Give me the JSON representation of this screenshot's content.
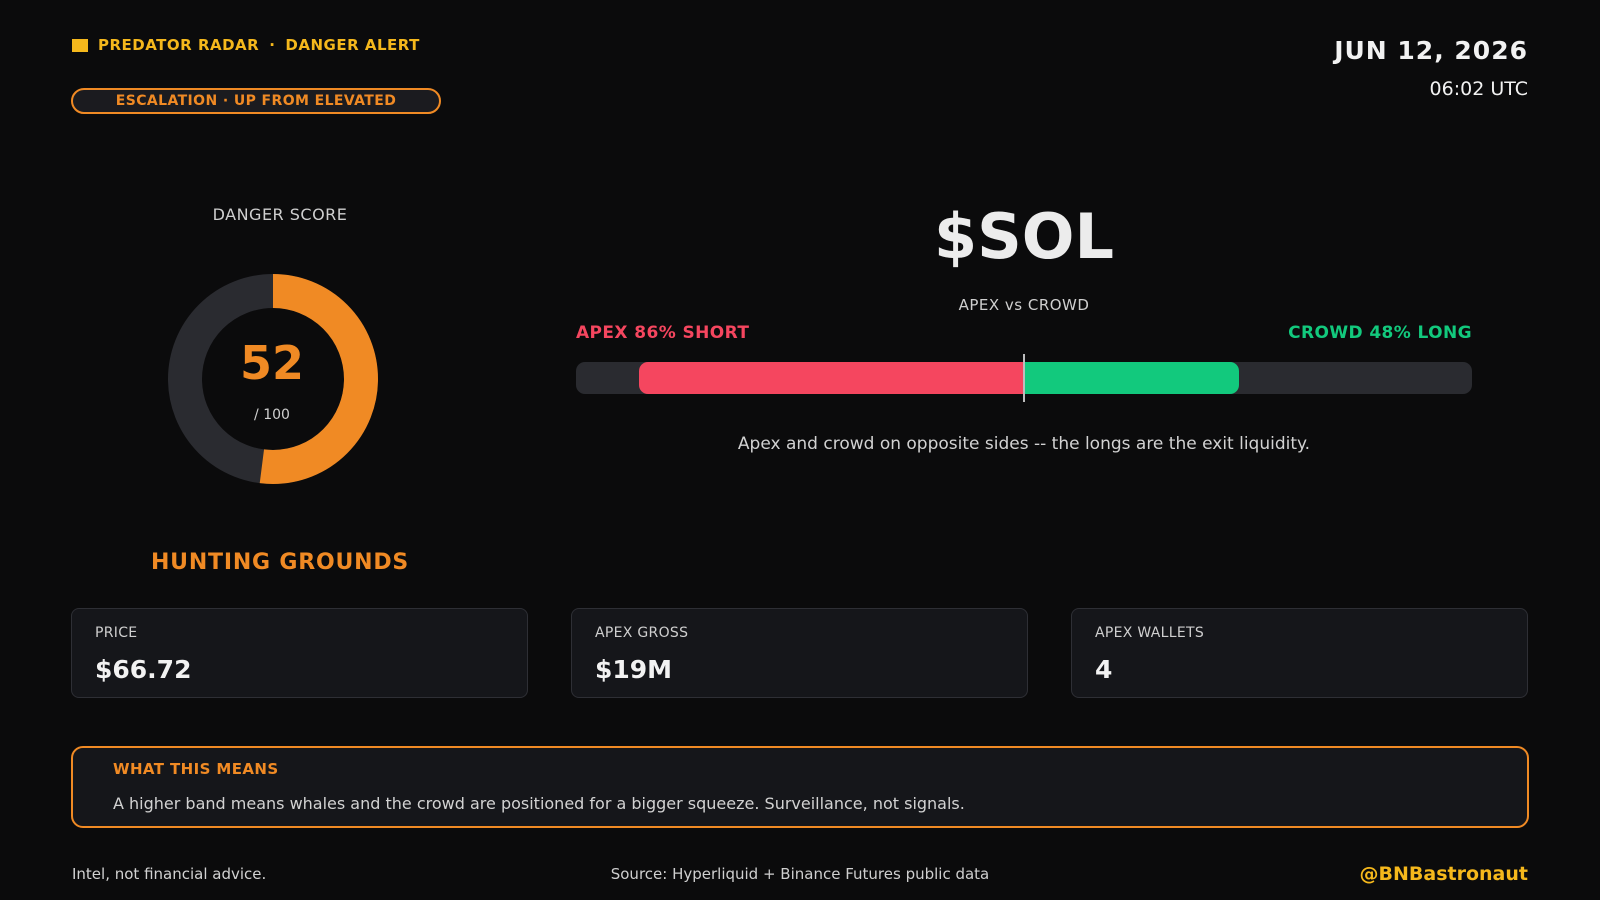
{
  "header": {
    "brand_left": "PREDATOR RADAR",
    "brand_sep": "·",
    "brand_right": "DANGER ALERT",
    "escalation": "ESCALATION · UP FROM ELEVATED",
    "date": "JUN 12, 2026",
    "time": "06:02 UTC"
  },
  "danger": {
    "label": "DANGER SCORE",
    "score": "52",
    "max": "/ 100",
    "fraction": 0.52
  },
  "positioning": {
    "ticker": "$SOL",
    "vs_label": "APEX  vs  CROWD",
    "apex_label": "APEX 86% SHORT",
    "crowd_label": "CROWD 48% LONG",
    "apex_short_pct": 86,
    "crowd_long_pct": 48,
    "caption": "Apex and crowd on opposite sides -- the longs are the exit liquidity."
  },
  "hunting": {
    "title": "HUNTING GROUNDS",
    "cards": [
      {
        "label": "PRICE",
        "value": "$66.72"
      },
      {
        "label": "APEX GROSS",
        "value": "$19M"
      },
      {
        "label": "APEX WALLETS",
        "value": "4"
      }
    ]
  },
  "means": {
    "title": "WHAT THIS MEANS",
    "text": "A higher band means whales and the crowd are positioned for a bigger squeeze. Surveillance, not signals."
  },
  "footer": {
    "disclaimer": "Intel, not financial advice.",
    "source": "Source: Hyperliquid + Binance Futures public data",
    "handle": "@BNBastronaut"
  },
  "colors": {
    "accent_yellow": "#f5b81c",
    "accent_orange": "#f08a24",
    "short_red": "#f5465f",
    "long_green": "#12c97d",
    "track": "#2a2b30"
  }
}
